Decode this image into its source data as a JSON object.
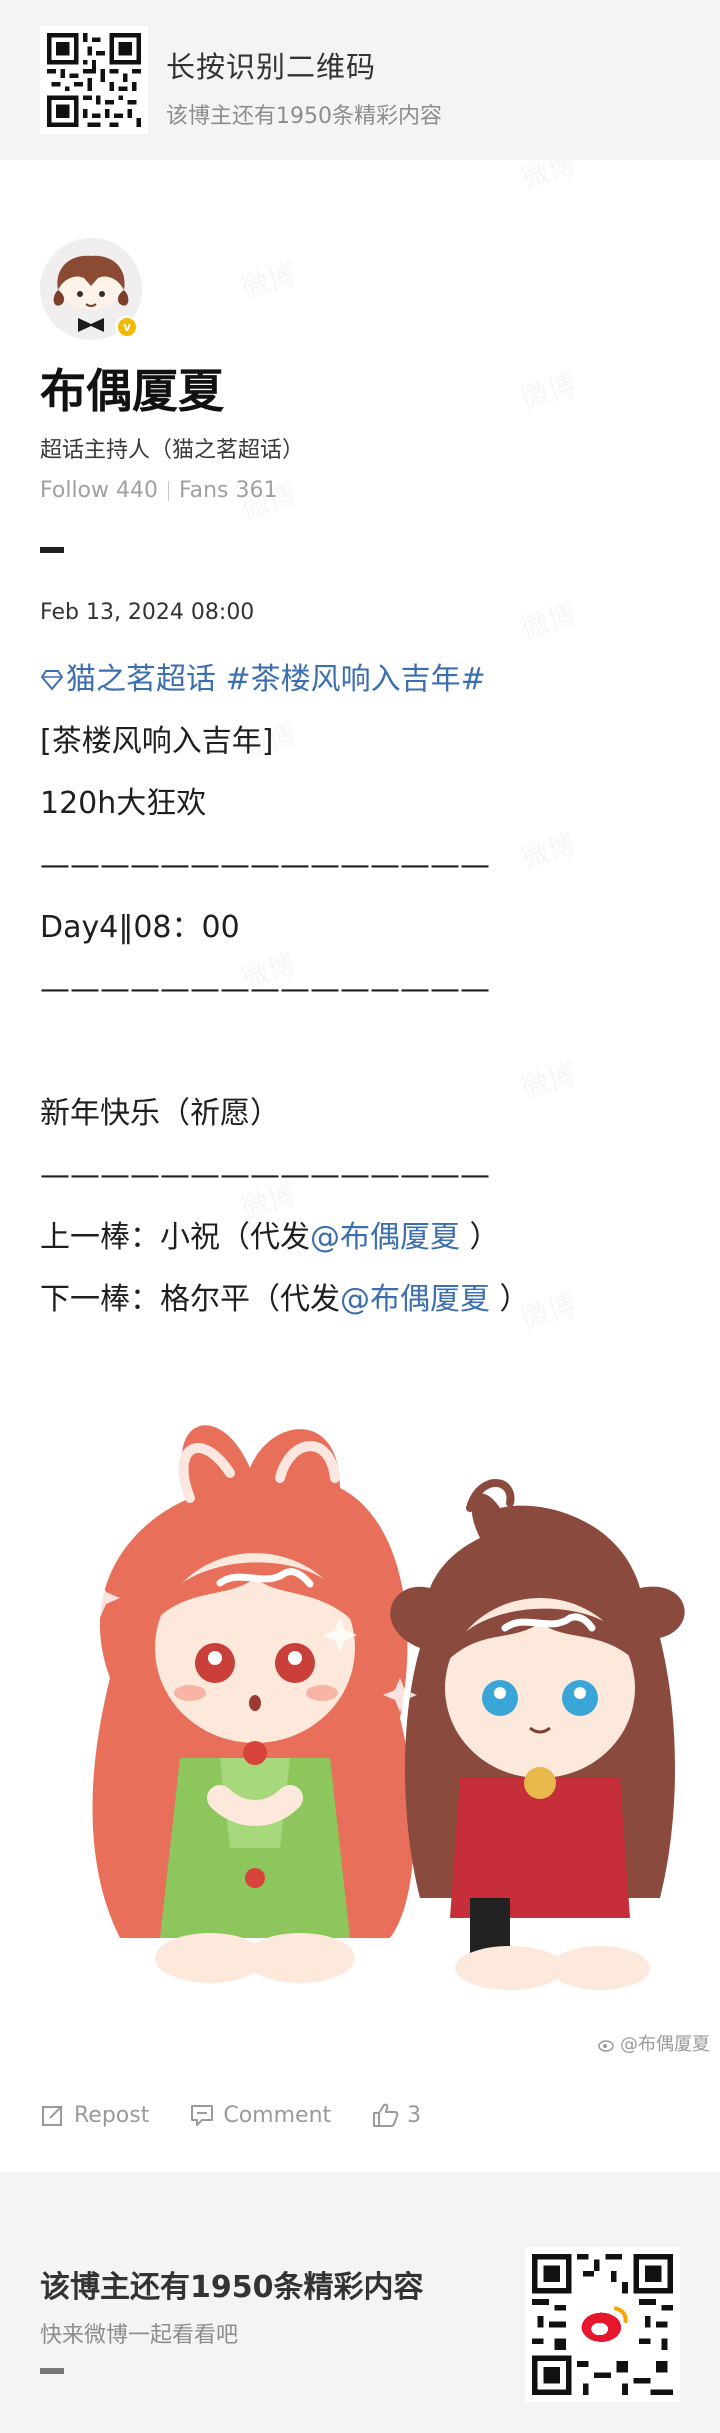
{
  "top_banner": {
    "title": "长按识别二维码",
    "subtitle": "该博主还有1950条精彩内容"
  },
  "profile": {
    "name": "布偶厦夏",
    "title": "超话主持人（猫之茗超话）",
    "follow_label": "Follow 440",
    "fans_label": "Fans 361",
    "badge": "v"
  },
  "post": {
    "date": "Feb 13, 2024 08:00",
    "topic1": "猫之茗超话",
    "topic2": "#茶楼风响入吉年#",
    "line_bracket": "[茶楼风响入吉年]",
    "line_event": "120h大狂欢",
    "divider": "———————————————",
    "line_day": "Day4‖08：00",
    "line_blank": "",
    "line_wish": "新年快乐（祈愿）",
    "prev_prefix": "上一棒：小祝（代发",
    "prev_mention": "@布偶厦夏",
    "prev_suffix": " ）",
    "next_prefix": "下一棒：格尔平（代发",
    "next_mention": "@布偶厦夏",
    "next_suffix": " ）"
  },
  "image": {
    "watermark": "@布偶厦夏"
  },
  "actions": {
    "repost": "Repost",
    "comment": "Comment",
    "like_count": "3"
  },
  "bottom_banner": {
    "title": "该博主还有1950条精彩内容",
    "subtitle": "快来微博一起看看吧"
  },
  "colors": {
    "link": "#3d6fb0",
    "banner_bg": "#f4f4f4",
    "verified_badge": "#f5b800"
  },
  "icons": [
    "qr-code-icon",
    "diamond-icon",
    "repost-icon",
    "comment-icon",
    "like-icon",
    "weibo-logo-icon"
  ]
}
